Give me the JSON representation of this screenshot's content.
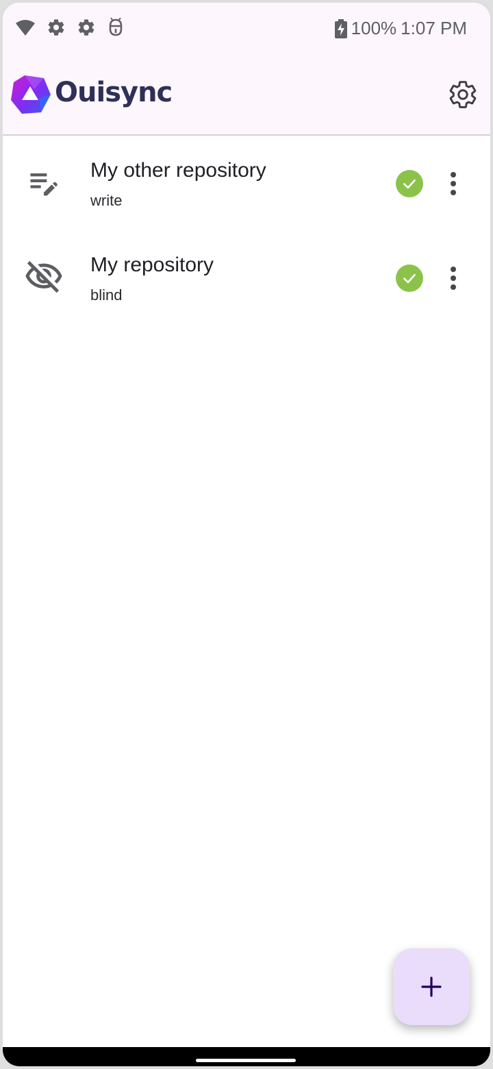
{
  "status_bar": {
    "icons": [
      "wifi-icon",
      "settings-notification-icon",
      "settings-notification-icon",
      "debug-icon"
    ],
    "battery_icon": "battery-charging-icon",
    "battery_text": "100%",
    "time": "1:07 PM"
  },
  "app_bar": {
    "logo_icon": "ouisync-logo-icon",
    "title": "Ouisync",
    "settings_icon": "gear-icon"
  },
  "repositories": [
    {
      "name": "My other repository",
      "access": "write",
      "lead_icon": "edit-note-icon",
      "status_icon": "synced-check-icon",
      "menu_icon": "more-vert-icon"
    },
    {
      "name": "My repository",
      "access": "blind",
      "lead_icon": "visibility-off-icon",
      "status_icon": "synced-check-icon",
      "menu_icon": "more-vert-icon"
    }
  ],
  "fab": {
    "icon": "add-icon"
  },
  "colors": {
    "top_band": "#fdf6fd",
    "brand_text": "#2f3058",
    "status_ok": "#8bc34a",
    "fab_bg": "#eadcfb",
    "fab_icon": "#22005d",
    "icon_gray": "#5d5d62"
  }
}
